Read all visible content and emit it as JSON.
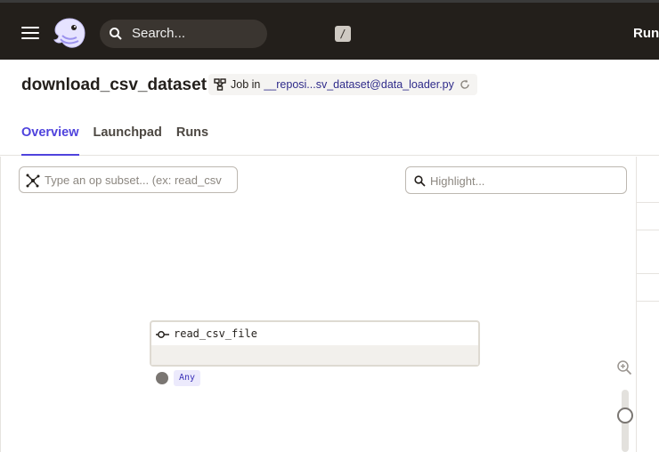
{
  "topbar": {
    "search_placeholder": "Search...",
    "search_shortcut": "/",
    "runs_label": "Runs"
  },
  "header": {
    "title": "download_csv_dataset",
    "job_prefix": "Job in",
    "job_link": "__reposi...sv_dataset@data_loader.py",
    "tabs": [
      {
        "label": "Overview",
        "active": true
      },
      {
        "label": "Launchpad",
        "active": false
      },
      {
        "label": "Runs",
        "active": false
      }
    ]
  },
  "graph": {
    "subset_placeholder": "Type an op subset... (ex: read_csv",
    "highlight_placeholder": "Highlight...",
    "op": {
      "name": "read_csv_file",
      "output_type": "Any"
    }
  },
  "colors": {
    "topbar_bg": "#231f1b",
    "accent": "#4f43dd"
  },
  "icons": [
    "menu-icon",
    "dagster-logo",
    "search-icon",
    "job-graph-icon",
    "reload-icon",
    "op-subset-icon",
    "op-icon",
    "zoom-in-icon"
  ]
}
